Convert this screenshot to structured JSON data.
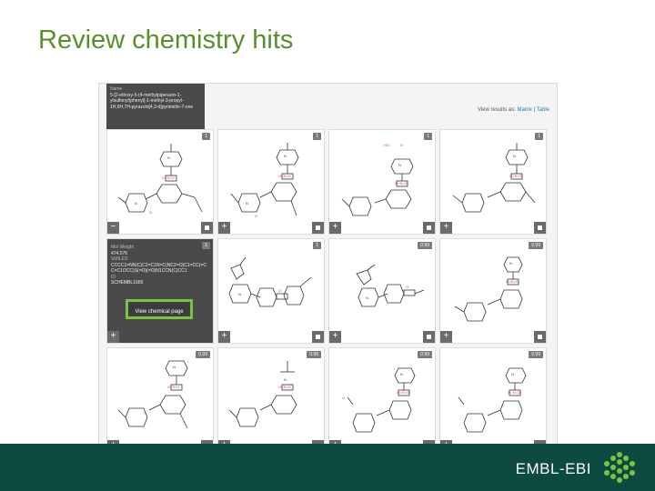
{
  "slide": {
    "title": "Review chemistry hits"
  },
  "tooltip_top": {
    "label": "Name",
    "text": "5-[2-ethoxy-5-(4-methylpiperazin-1-ylsulfonyl)phenyl]-1-methyl-3-propyl-1H,6H,7H-pyrazolo[4,3-d]pyrimidin-7-one"
  },
  "view_results": {
    "prefix": "View results as:",
    "matrix": "Matrix",
    "sep": "|",
    "table": "Table"
  },
  "hover": {
    "mw_label": "Mol Weight",
    "mw_value": "474.576",
    "smiles_label": "SMILES",
    "smiles_value": "CCCC1=NN(C)C2=C1N=C(NC2=O)C1=CC(=CC=C1OCC)S(=O)(=O)N1CCN(C)CC1",
    "id_label": "ID",
    "id_value": "SCHEMBL1665",
    "button": "View chemical page"
  },
  "cells": [
    {
      "score": "1",
      "left": "−",
      "dark": false
    },
    {
      "score": "1",
      "left": "+",
      "dark": false
    },
    {
      "score": "1",
      "left": "+",
      "dark": false
    },
    {
      "score": "1",
      "left": "+",
      "dark": false
    },
    {
      "score": "1",
      "left": "+",
      "dark": true
    },
    {
      "score": "1",
      "left": "+",
      "dark": false
    },
    {
      "score": "0.99",
      "left": "+",
      "dark": false
    },
    {
      "score": "0.99",
      "left": "+",
      "dark": false
    },
    {
      "score": "0.99",
      "left": "+",
      "dark": false
    },
    {
      "score": "0.99",
      "left": "+",
      "dark": false
    },
    {
      "score": "0.99",
      "left": "+",
      "dark": false
    },
    {
      "score": "0.99",
      "left": "+",
      "dark": false
    }
  ],
  "footer": {
    "brand": "EMBL-EBI"
  },
  "icons": {
    "add": "plus-icon",
    "select": "square-icon",
    "logo": "embl-ebi-logo"
  },
  "colors": {
    "title": "#5a8f2e",
    "footer": "#0d4a40",
    "highlight": "#7dc242"
  }
}
